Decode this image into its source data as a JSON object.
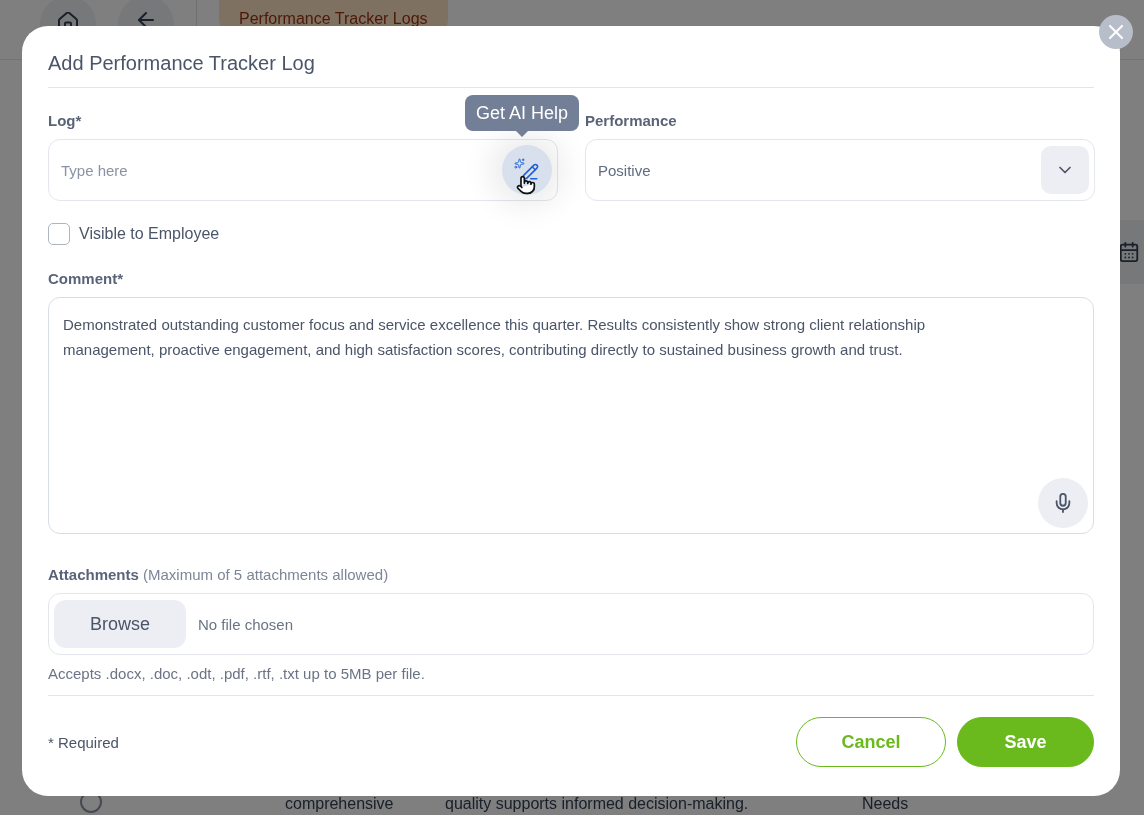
{
  "background": {
    "tab": "Performance Tracker Logs",
    "row": {
      "selected": false,
      "column_1": "comprehensive",
      "column_2": "quality supports informed decision-making.",
      "column_3": "Needs"
    }
  },
  "dialog": {
    "title": "Add Performance Tracker Log",
    "log": {
      "label": "Log*",
      "placeholder": "Type here",
      "tooltip": "Get AI Help"
    },
    "performance": {
      "label": "Performance",
      "value": "Positive"
    },
    "visible_to_employee": {
      "label": "Visible to Employee",
      "checked": false
    },
    "comment": {
      "label": "Comment*",
      "value": "Demonstrated outstanding customer focus and service excellence this quarter. Results consistently show strong client relationship management, proactive engagement, and high satisfaction scores, contributing directly to sustained business growth and trust."
    },
    "attachments": {
      "label": "Attachments",
      "note": "(Maximum of 5 attachments allowed)",
      "button": "Browse",
      "status": "No file chosen",
      "hint": "Accepts .docx, .doc, .odt, .pdf, .rtf, .txt up to 5MB per file."
    },
    "required_note": "* Required",
    "buttons": [
      {
        "label": "Cancel",
        "kind": "secondary"
      },
      {
        "label": "Save",
        "kind": "primary"
      }
    ]
  }
}
